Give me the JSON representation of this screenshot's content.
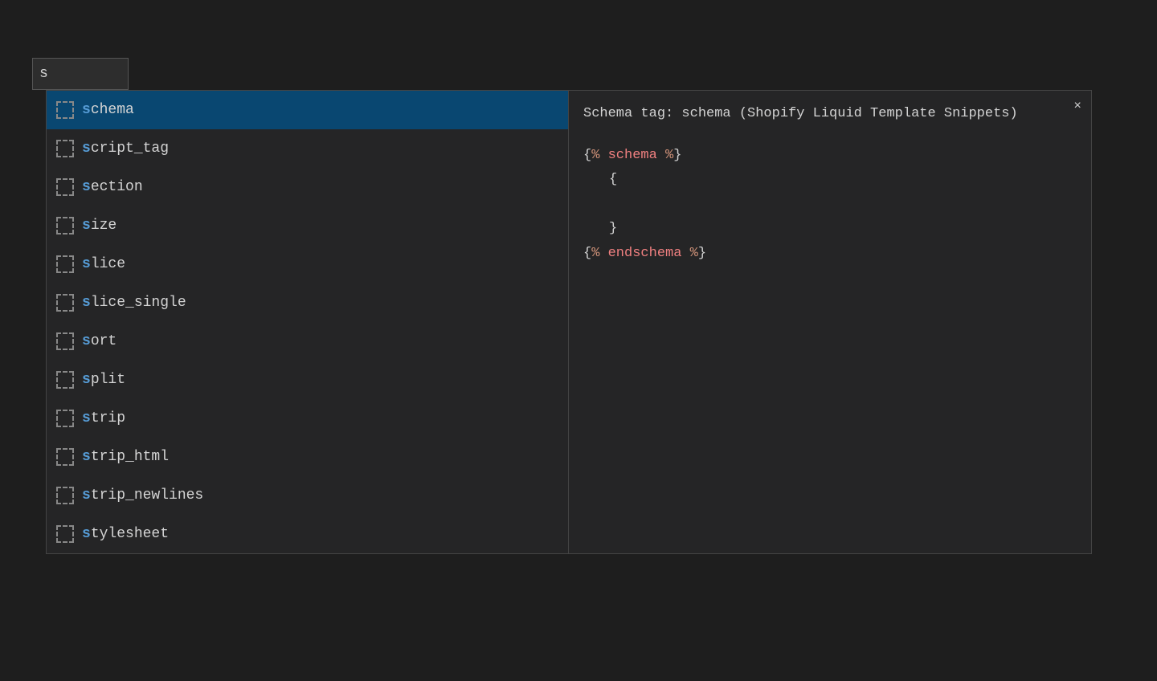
{
  "searchBar": {
    "value": "s",
    "placeholder": ""
  },
  "suggestions": [
    {
      "id": "schema",
      "prefix": "s",
      "rest": "chema",
      "active": true
    },
    {
      "id": "script_tag",
      "prefix": "s",
      "rest": "cript_tag",
      "active": false
    },
    {
      "id": "section",
      "prefix": "s",
      "rest": "ection",
      "active": false
    },
    {
      "id": "size",
      "prefix": "s",
      "rest": "ize",
      "active": false
    },
    {
      "id": "slice",
      "prefix": "s",
      "rest": "lice",
      "active": false
    },
    {
      "id": "slice_single",
      "prefix": "s",
      "rest": "lice_single",
      "active": false
    },
    {
      "id": "sort",
      "prefix": "s",
      "rest": "ort",
      "active": false
    },
    {
      "id": "split",
      "prefix": "s",
      "rest": "plit",
      "active": false
    },
    {
      "id": "strip",
      "prefix": "s",
      "rest": "trip",
      "active": false
    },
    {
      "id": "strip_html",
      "prefix": "s",
      "rest": "trip_html",
      "active": false
    },
    {
      "id": "strip_newlines",
      "prefix": "s",
      "rest": "trip_newlines",
      "active": false
    },
    {
      "id": "stylesheet",
      "prefix": "s",
      "rest": "tylesheet",
      "active": false
    }
  ],
  "docPanel": {
    "title": "Schema tag: schema (Shopify Liquid Template Snippets)",
    "closeLabel": "×",
    "codeLines": [
      {
        "type": "tag",
        "open": "{% ",
        "name": "schema",
        "close": " %}"
      },
      {
        "type": "plain",
        "text": "    {"
      },
      {
        "type": "plain",
        "text": ""
      },
      {
        "type": "plain",
        "text": "    }"
      },
      {
        "type": "tag",
        "open": "{% ",
        "name": "endschema",
        "close": " %}"
      }
    ]
  },
  "colors": {
    "background": "#1e1e1e",
    "panelBg": "#252526",
    "activeItem": "#094771",
    "highlightBlue": "#569cd6",
    "tagNamePink": "#f08080",
    "punctuation": "#d4d4d4",
    "iconBorder": "#888888"
  }
}
